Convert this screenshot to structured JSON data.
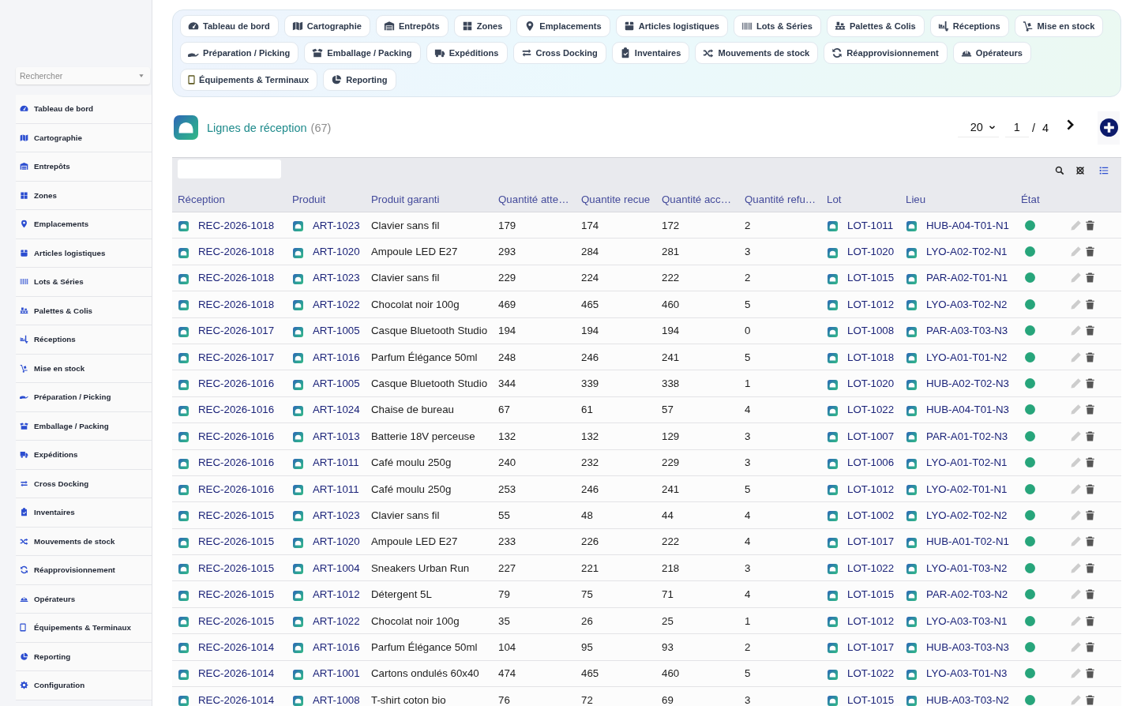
{
  "sidebar": {
    "search": {
      "placeholder": "Rechercher"
    },
    "items": [
      {
        "label": "Tableau de bord",
        "selected": false
      },
      {
        "label": "Cartographie",
        "selected": false
      },
      {
        "label": "Entrepôts",
        "selected": false
      },
      {
        "label": "Zones",
        "selected": false
      },
      {
        "label": "Emplacements",
        "selected": false
      },
      {
        "label": "Articles logistiques",
        "selected": false
      },
      {
        "label": "Lots & Séries",
        "selected": false
      },
      {
        "label": "Palettes & Colis",
        "selected": false
      },
      {
        "label": "Réceptions",
        "selected": false
      },
      {
        "label": "Mise en stock",
        "selected": false
      },
      {
        "label": "Préparation / Picking",
        "selected": false
      },
      {
        "label": "Emballage / Packing",
        "selected": false
      },
      {
        "label": "Expéditions",
        "selected": false
      },
      {
        "label": "Cross Docking",
        "selected": false
      },
      {
        "label": "Inventaires",
        "selected": false
      },
      {
        "label": "Mouvements de stock",
        "selected": false
      },
      {
        "label": "Réapprovisionnement",
        "selected": false
      },
      {
        "label": "Opérateurs",
        "selected": false
      },
      {
        "label": "Équipements & Terminaux",
        "selected": false
      },
      {
        "label": "Reporting",
        "selected": false
      },
      {
        "label": "Configuration",
        "selected": false
      }
    ]
  },
  "modules": [
    {
      "label": "Tableau de bord",
      "selected": false
    },
    {
      "label": "Cartographie",
      "selected": false
    },
    {
      "label": "Entrepôts",
      "selected": false
    },
    {
      "label": "Zones",
      "selected": false
    },
    {
      "label": "Emplacements",
      "selected": false
    },
    {
      "label": "Articles logistiques",
      "selected": false
    },
    {
      "label": "Lots & Séries",
      "selected": false
    },
    {
      "label": "Palettes & Colis",
      "selected": false
    },
    {
      "label": "Réceptions",
      "selected": false
    },
    {
      "label": "Mise en stock",
      "selected": false
    },
    {
      "label": "Préparation / Picking",
      "selected": false
    },
    {
      "label": "Emballage / Packing",
      "selected": false
    },
    {
      "label": "Expéditions",
      "selected": false
    },
    {
      "label": "Cross Docking",
      "selected": false
    },
    {
      "label": "Inventaires",
      "selected": false
    },
    {
      "label": "Mouvements de stock",
      "selected": false
    },
    {
      "label": "Réapprovisionnement",
      "selected": false
    },
    {
      "label": "Opérateurs",
      "selected": false
    },
    {
      "label": "Équipements & Terminaux",
      "selected": false
    },
    {
      "label": "Reporting",
      "selected": false
    }
  ],
  "page_header": {
    "title": "Lignes de réception",
    "count": "(67)",
    "page_size": "20",
    "page": "1",
    "page_separator": "/",
    "page_count": "4"
  },
  "table": {
    "columns": [
      {
        "label": "Réception",
        "kind": "link"
      },
      {
        "label": "Produit",
        "kind": "link"
      },
      {
        "label": "Produit garanti",
        "kind": "text"
      },
      {
        "label": "Quantité atte…",
        "kind": "text"
      },
      {
        "label": "Quantite recue",
        "kind": "text"
      },
      {
        "label": "Quantité acc…",
        "kind": "text"
      },
      {
        "label": "Quantité refu…",
        "kind": "text"
      },
      {
        "label": "Lot",
        "kind": "link"
      },
      {
        "label": "Lieu",
        "kind": "link"
      },
      {
        "label": "État",
        "kind": "status"
      }
    ],
    "rows": [
      {
        "cells": [
          "REC-2026-1018",
          "ART-1023",
          "Clavier sans fil",
          "179",
          "174",
          "172",
          "2",
          "LOT-1011",
          "HUB-A04-T01-N1"
        ],
        "color": "#27a57b"
      },
      {
        "cells": [
          "REC-2026-1018",
          "ART-1020",
          "Ampoule LED E27",
          "293",
          "284",
          "281",
          "3",
          "LOT-1020",
          "LYO-A02-T02-N1"
        ],
        "color": "#27a57b"
      },
      {
        "cells": [
          "REC-2026-1018",
          "ART-1023",
          "Clavier sans fil",
          "229",
          "224",
          "222",
          "2",
          "LOT-1015",
          "PAR-A02-T01-N1"
        ],
        "color": "#27a57b"
      },
      {
        "cells": [
          "REC-2026-1018",
          "ART-1022",
          "Chocolat noir 100g",
          "469",
          "465",
          "460",
          "5",
          "LOT-1012",
          "LYO-A03-T02-N2"
        ],
        "color": "#27a57b"
      },
      {
        "cells": [
          "REC-2026-1017",
          "ART-1005",
          "Casque Bluetooth Studio",
          "194",
          "194",
          "194",
          "0",
          "LOT-1008",
          "PAR-A03-T03-N3"
        ],
        "color": "#27a57b"
      },
      {
        "cells": [
          "REC-2026-1017",
          "ART-1016",
          "Parfum Élégance 50ml",
          "248",
          "246",
          "241",
          "5",
          "LOT-1018",
          "LYO-A01-T01-N2"
        ],
        "color": "#27a57b"
      },
      {
        "cells": [
          "REC-2026-1016",
          "ART-1005",
          "Casque Bluetooth Studio",
          "344",
          "339",
          "338",
          "1",
          "LOT-1020",
          "HUB-A02-T02-N3"
        ],
        "color": "#27a57b"
      },
      {
        "cells": [
          "REC-2026-1016",
          "ART-1024",
          "Chaise de bureau",
          "67",
          "61",
          "57",
          "4",
          "LOT-1022",
          "HUB-A04-T01-N3"
        ],
        "color": "#27a57b"
      },
      {
        "cells": [
          "REC-2026-1016",
          "ART-1013",
          "Batterie 18V perceuse",
          "132",
          "132",
          "129",
          "3",
          "LOT-1007",
          "PAR-A01-T02-N3"
        ],
        "color": "#27a57b"
      },
      {
        "cells": [
          "REC-2026-1016",
          "ART-1011",
          "Café moulu 250g",
          "240",
          "232",
          "229",
          "3",
          "LOT-1006",
          "LYO-A01-T02-N1"
        ],
        "color": "#27a57b"
      },
      {
        "cells": [
          "REC-2026-1016",
          "ART-1011",
          "Café moulu 250g",
          "253",
          "246",
          "241",
          "5",
          "LOT-1012",
          "LYO-A02-T01-N1"
        ],
        "color": "#27a57b"
      },
      {
        "cells": [
          "REC-2026-1015",
          "ART-1023",
          "Clavier sans fil",
          "55",
          "48",
          "44",
          "4",
          "LOT-1002",
          "LYO-A02-T02-N2"
        ],
        "color": "#27a57b"
      },
      {
        "cells": [
          "REC-2026-1015",
          "ART-1020",
          "Ampoule LED E27",
          "233",
          "226",
          "222",
          "4",
          "LOT-1017",
          "HUB-A01-T02-N1"
        ],
        "color": "#27a57b"
      },
      {
        "cells": [
          "REC-2026-1015",
          "ART-1004",
          "Sneakers Urban Run",
          "227",
          "221",
          "218",
          "3",
          "LOT-1022",
          "LYO-A01-T03-N2"
        ],
        "color": "#27a57b"
      },
      {
        "cells": [
          "REC-2026-1015",
          "ART-1012",
          "Détergent 5L",
          "79",
          "75",
          "71",
          "4",
          "LOT-1015",
          "PAR-A02-T03-N2"
        ],
        "color": "#27a57b"
      },
      {
        "cells": [
          "REC-2026-1015",
          "ART-1022",
          "Chocolat noir 100g",
          "35",
          "26",
          "25",
          "1",
          "LOT-1012",
          "LYO-A03-T03-N1"
        ],
        "color": "#27a57b"
      },
      {
        "cells": [
          "REC-2026-1014",
          "ART-1016",
          "Parfum Élégance 50ml",
          "104",
          "95",
          "93",
          "2",
          "LOT-1017",
          "HUB-A03-T03-N3"
        ],
        "color": "#27a57b"
      },
      {
        "cells": [
          "REC-2026-1014",
          "ART-1001",
          "Cartons ondulés 60x40",
          "474",
          "465",
          "460",
          "5",
          "LOT-1022",
          "LYO-A03-T01-N3"
        ],
        "color": "#27a57b"
      },
      {
        "cells": [
          "REC-2026-1014",
          "ART-1008",
          "T-shirt coton bio",
          "76",
          "72",
          "69",
          "3",
          "LOT-1015",
          "HUB-A03-T03-N2"
        ],
        "color": "#27a57b"
      }
    ]
  }
}
